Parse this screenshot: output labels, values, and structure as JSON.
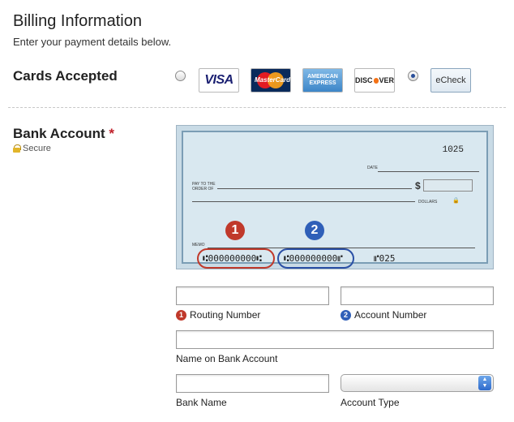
{
  "header": {
    "title": "Billing Information",
    "subtitle": "Enter your payment details below."
  },
  "cards_accepted": {
    "heading": "Cards Accepted",
    "logos": {
      "visa": "VISA",
      "mastercard": "MasterCard",
      "amex_line1": "AMERICAN",
      "amex_line2": "EXPRESS",
      "discover_a": "DISC",
      "discover_b": "VER",
      "echeck": "eCheck"
    },
    "selected": "echeck"
  },
  "bank_account": {
    "heading": "Bank Account",
    "required_mark": "*",
    "secure_label": "Secure",
    "check": {
      "check_number": "1025",
      "date_label": "DATE",
      "pay_to_line1": "PAY TO THE",
      "pay_to_line2": "ORDER OF",
      "dollar_sign": "$",
      "dollars_label": "DOLLARS",
      "memo_label": "MEMO",
      "micr_routing": "⑆000000000⑆",
      "micr_account": "⑆000000000⑈",
      "micr_check_number": "⑈025",
      "badge_routing": "1",
      "badge_account": "2"
    }
  },
  "form": {
    "routing_number_label": "Routing Number",
    "routing_number_value": "",
    "account_number_label": "Account Number",
    "account_number_value": "",
    "name_on_account_label": "Name on Bank Account",
    "name_on_account_value": "",
    "bank_name_label": "Bank Name",
    "bank_name_value": "",
    "account_type_label": "Account Type",
    "account_type_value": "",
    "badge_1": "1",
    "badge_2": "2"
  },
  "colors": {
    "routing_accent": "#c0392b",
    "account_accent": "#2f5fb8",
    "check_background": "#d9e8f0"
  }
}
